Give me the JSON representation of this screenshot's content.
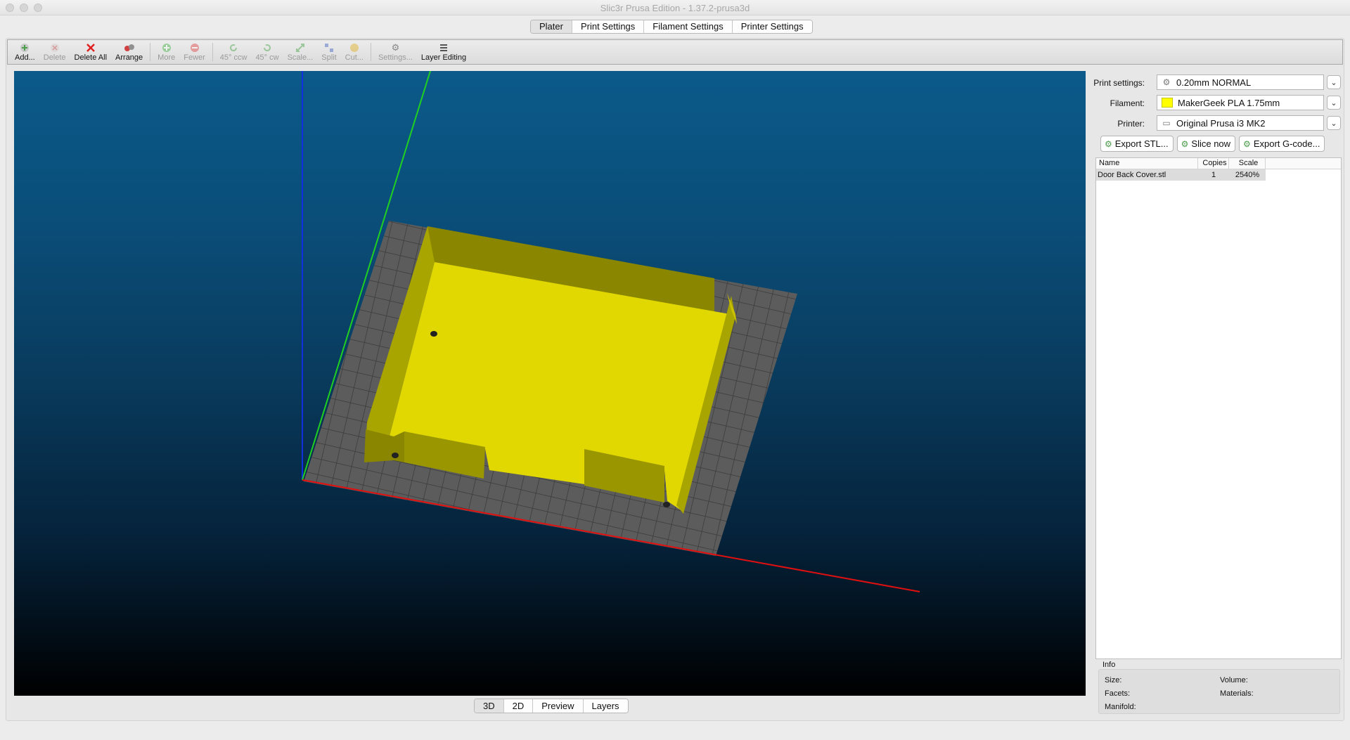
{
  "window": {
    "title": "Slic3r Prusa Edition - 1.37.2-prusa3d"
  },
  "main_tabs": [
    {
      "label": "Plater",
      "active": true
    },
    {
      "label": "Print Settings",
      "active": false
    },
    {
      "label": "Filament Settings",
      "active": false
    },
    {
      "label": "Printer Settings",
      "active": false
    }
  ],
  "toolbar": {
    "add": "Add...",
    "delete": "Delete",
    "delete_all": "Delete All",
    "arrange": "Arrange",
    "more": "More",
    "fewer": "Fewer",
    "rotate_ccw": "45° ccw",
    "rotate_cw": "45° cw",
    "scale": "Scale...",
    "split": "Split",
    "cut": "Cut...",
    "settings": "Settings...",
    "layer_editing": "Layer Editing"
  },
  "view_tabs": [
    {
      "label": "3D",
      "active": true
    },
    {
      "label": "2D",
      "active": false
    },
    {
      "label": "Preview",
      "active": false
    },
    {
      "label": "Layers",
      "active": false
    }
  ],
  "settings": {
    "print_label": "Print settings:",
    "print_value": "0.20mm NORMAL",
    "filament_label": "Filament:",
    "filament_value": "MakerGeek PLA 1.75mm",
    "filament_color": "#ffff00",
    "printer_label": "Printer:",
    "printer_value": "Original Prusa i3 MK2"
  },
  "actions": {
    "export_stl": "Export STL...",
    "slice_now": "Slice now",
    "export_gcode": "Export G-code..."
  },
  "object_list": {
    "columns": [
      "Name",
      "Copies",
      "Scale"
    ],
    "rows": [
      {
        "name": "Door Back Cover.stl",
        "copies": "1",
        "scale": "2540%"
      }
    ]
  },
  "info": {
    "title": "Info",
    "size": "Size:",
    "volume": "Volume:",
    "facets": "Facets:",
    "materials": "Materials:",
    "manifold": "Manifold:"
  },
  "colors": {
    "model": "#e0d800",
    "model_wall": "#8a8600",
    "bed": "#5c5c5c",
    "axis_x": "#e01010",
    "axis_y": "#20d020",
    "axis_z": "#1030e0"
  }
}
